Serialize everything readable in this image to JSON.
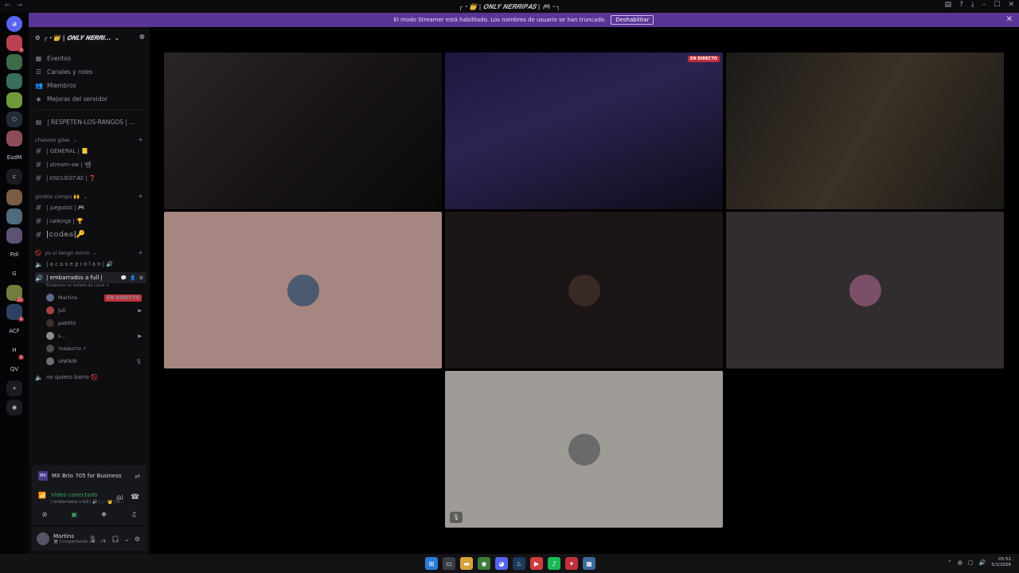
{
  "window": {
    "title": "╭・👑 | 𝑶𝑵𝑳𝒀 𝑵𝑬𝑹𝑹𝑰𝑷𝑨𝑺 | 🎮・╮"
  },
  "banner": {
    "text": "El modo Streamer está habilitado. Los nombres de usuario se han truncado.",
    "button": "Deshabilitar"
  },
  "guilds": [
    {
      "label": "",
      "color": "#b94150",
      "badge": "2"
    },
    {
      "label": "",
      "color": "#3c6b47",
      "badge": ""
    },
    {
      "label": "",
      "color": "#3a6d5d",
      "badge": ""
    },
    {
      "label": "",
      "color": "#6f9a3a",
      "badge": ""
    },
    {
      "label": "⬡",
      "color": "#222a38",
      "badge": ""
    },
    {
      "label": "",
      "color": "#8d4c57",
      "badge": ""
    },
    {
      "label": "EsdM",
      "color": "#050507",
      "badge": ""
    },
    {
      "label": "c",
      "color": "#1b1c21",
      "badge": ""
    },
    {
      "label": "",
      "color": "#7a5d43",
      "badge": ""
    },
    {
      "label": "",
      "color": "#4f6b7d",
      "badge": ""
    },
    {
      "label": "",
      "color": "#5d5273",
      "badge": ""
    },
    {
      "label": "Pdl",
      "color": "#050507",
      "badge": ""
    },
    {
      "label": "G",
      "color": "#050507",
      "badge": ""
    },
    {
      "label": "",
      "color": "#6f7d3e",
      "badge": "22"
    },
    {
      "label": "",
      "color": "#2d3f63",
      "badge": "1"
    },
    {
      "label": "ACF",
      "color": "#050507",
      "badge": ""
    },
    {
      "label": "H",
      "color": "#050507",
      "badge": "2"
    },
    {
      "label": "QV",
      "color": "#050507",
      "badge": ""
    },
    {
      "label": "+",
      "color": "#1b1c21",
      "badge": ""
    },
    {
      "label": "◉",
      "color": "#1b1c21",
      "badge": ""
    }
  ],
  "server": {
    "name": "╭・👑 | 𝑶𝑵𝑳𝒀 𝑵𝑬𝑹𝑹𝑰...",
    "menu": [
      "Eventos",
      "Canales y roles",
      "Miembros",
      "Mejoras del servidor"
    ],
    "pinned_channel": "| RESPETEN-LOS-RANGOS | ...",
    "categories": [
      {
        "name": "chateen giles",
        "channels": [
          "| GENERAL | 📒",
          "| stream-sw | 📽",
          "| 𝐸𝑁𝐶𝑈𝐸𝑆𝑇𝐴𝑆 | ❓"
        ]
      },
      {
        "name": "gordos compu 🙌",
        "channels": [
          "| 𝑗𝑢𝑒𝑔𝑢𝑖𝑡𝑜𝑠 | 🎮",
          "| 𝑟𝑎𝑛𝑘𝑖𝑛𝑔𝑠 | 🏆",
          "|𝚌𝚘𝚍𝚎𝚜|🔑"
        ]
      },
      {
        "name": "yo si tengo micro",
        "channels": []
      }
    ],
    "voice": {
      "aca_se_piolan": "| a c a s e p i o l a n | 🔊",
      "active": "| embarrados a full |",
      "active_status": "Establece un estado de canal ✐",
      "users": [
        {
          "name": "Martins",
          "color": "#5a6a8a",
          "right": "EN DIRECTO"
        },
        {
          "name": "juli",
          "color": "#a4433f",
          "right": "▶"
        },
        {
          "name": "pablito",
          "color": "#3b3030",
          "right": ""
        },
        {
          "name": "s...",
          "color": "#8c8f83",
          "right": "▶"
        },
        {
          "name": "ᴛʜᴇʙᴜɪᴛᴏ ⚡",
          "color": "#4c4c4c",
          "right": ""
        },
        {
          "name": "UNFAIR",
          "color": "#6f6f74",
          "right": "🎙"
        }
      ],
      "no_quiero_barro": "no quiero barro 🚫"
    }
  },
  "device": {
    "name": "MX Brio 705 for Business",
    "icon": "MX"
  },
  "connection": {
    "status": "Vídeo conectado",
    "channel": "| embarrados a full | 🔊 / ╭・👑 | O...",
    "controls": [
      "camera-off",
      "screen-share",
      "activities",
      "soundboard"
    ]
  },
  "user": {
    "name": "Martins",
    "status": "🖥 Compartiendo su ...",
    "tag": "+1"
  },
  "tiles": [
    {
      "kind": "video",
      "bg": "linear-gradient(135deg,#2a2527 0%,#151214 60%,#0a0809 100%)",
      "live": ""
    },
    {
      "kind": "video",
      "bg": "linear-gradient(160deg,#1d1640 0%,#2b2452 40%,#0d0c18 100%)",
      "live": "EN DIRECTO"
    },
    {
      "kind": "video",
      "bg": "linear-gradient(120deg,#1c1a18 0%,#3a3226 50%,#1a1816 100%)",
      "live": ""
    },
    {
      "kind": "avatar",
      "bg": "#a68680",
      "avatar": "#4a5a70",
      "live": ""
    },
    {
      "kind": "avatar",
      "bg": "#1b1515",
      "avatar": "#3a2a26",
      "live": ""
    },
    {
      "kind": "avatar",
      "bg": "#312c2d",
      "avatar": "#7b4f68",
      "live": ""
    },
    {
      "kind": "avatar",
      "bg": "#9f9c98",
      "avatar": "#6a6a6a",
      "live": "",
      "muted": true
    }
  ],
  "taskbar": {
    "time": "05:52",
    "date": "5/1/2026"
  }
}
